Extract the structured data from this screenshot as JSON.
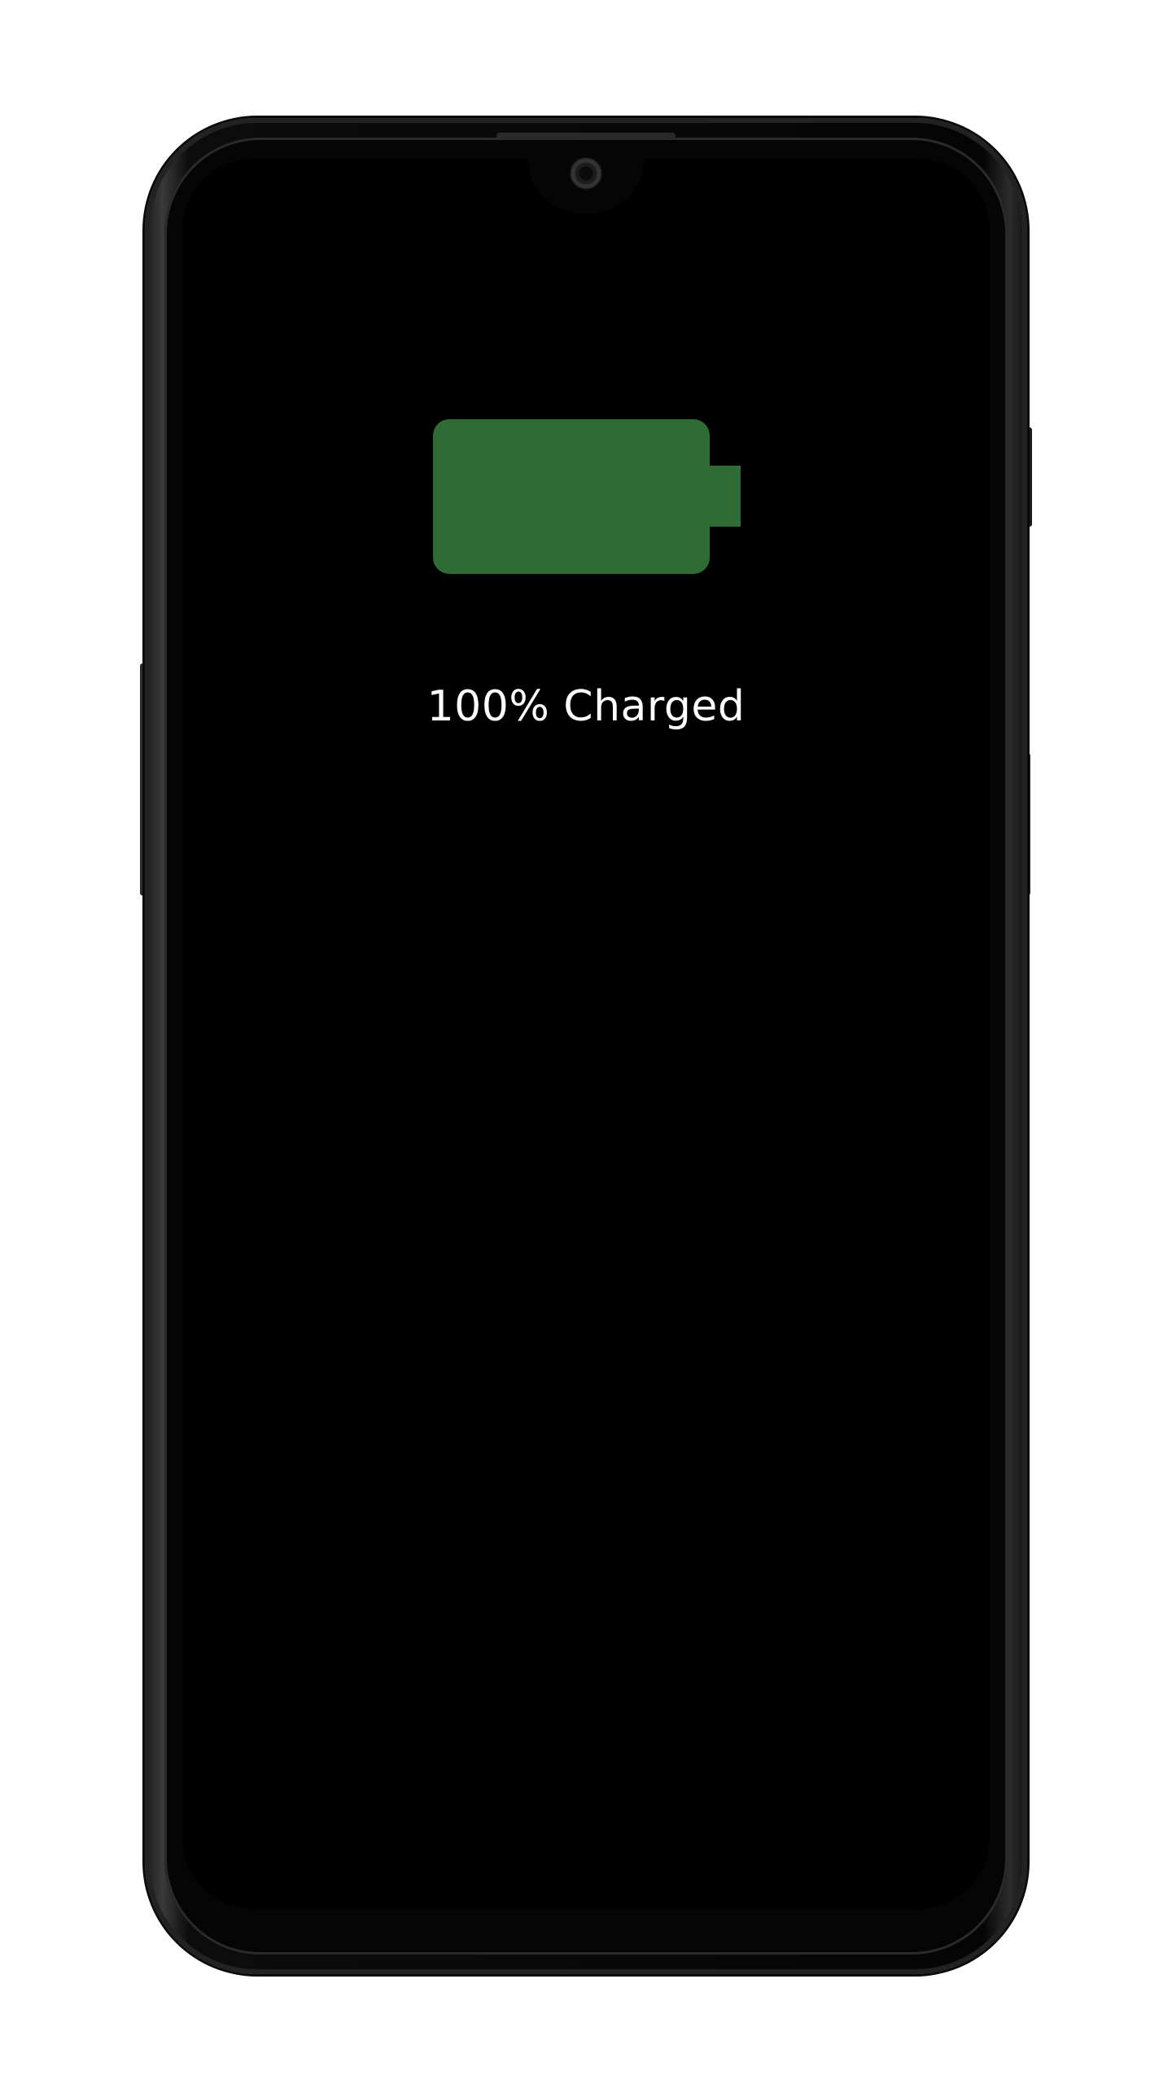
{
  "charging_screen": {
    "status_label": "100% Charged",
    "battery_level_percent": 100,
    "battery_color": "#2e6b35",
    "text_color": "#ffffff",
    "background_color": "#000000"
  },
  "device": {
    "frame_color": "#0a0a0a"
  },
  "icons": {
    "battery": "battery-full-icon",
    "camera": "front-camera"
  }
}
